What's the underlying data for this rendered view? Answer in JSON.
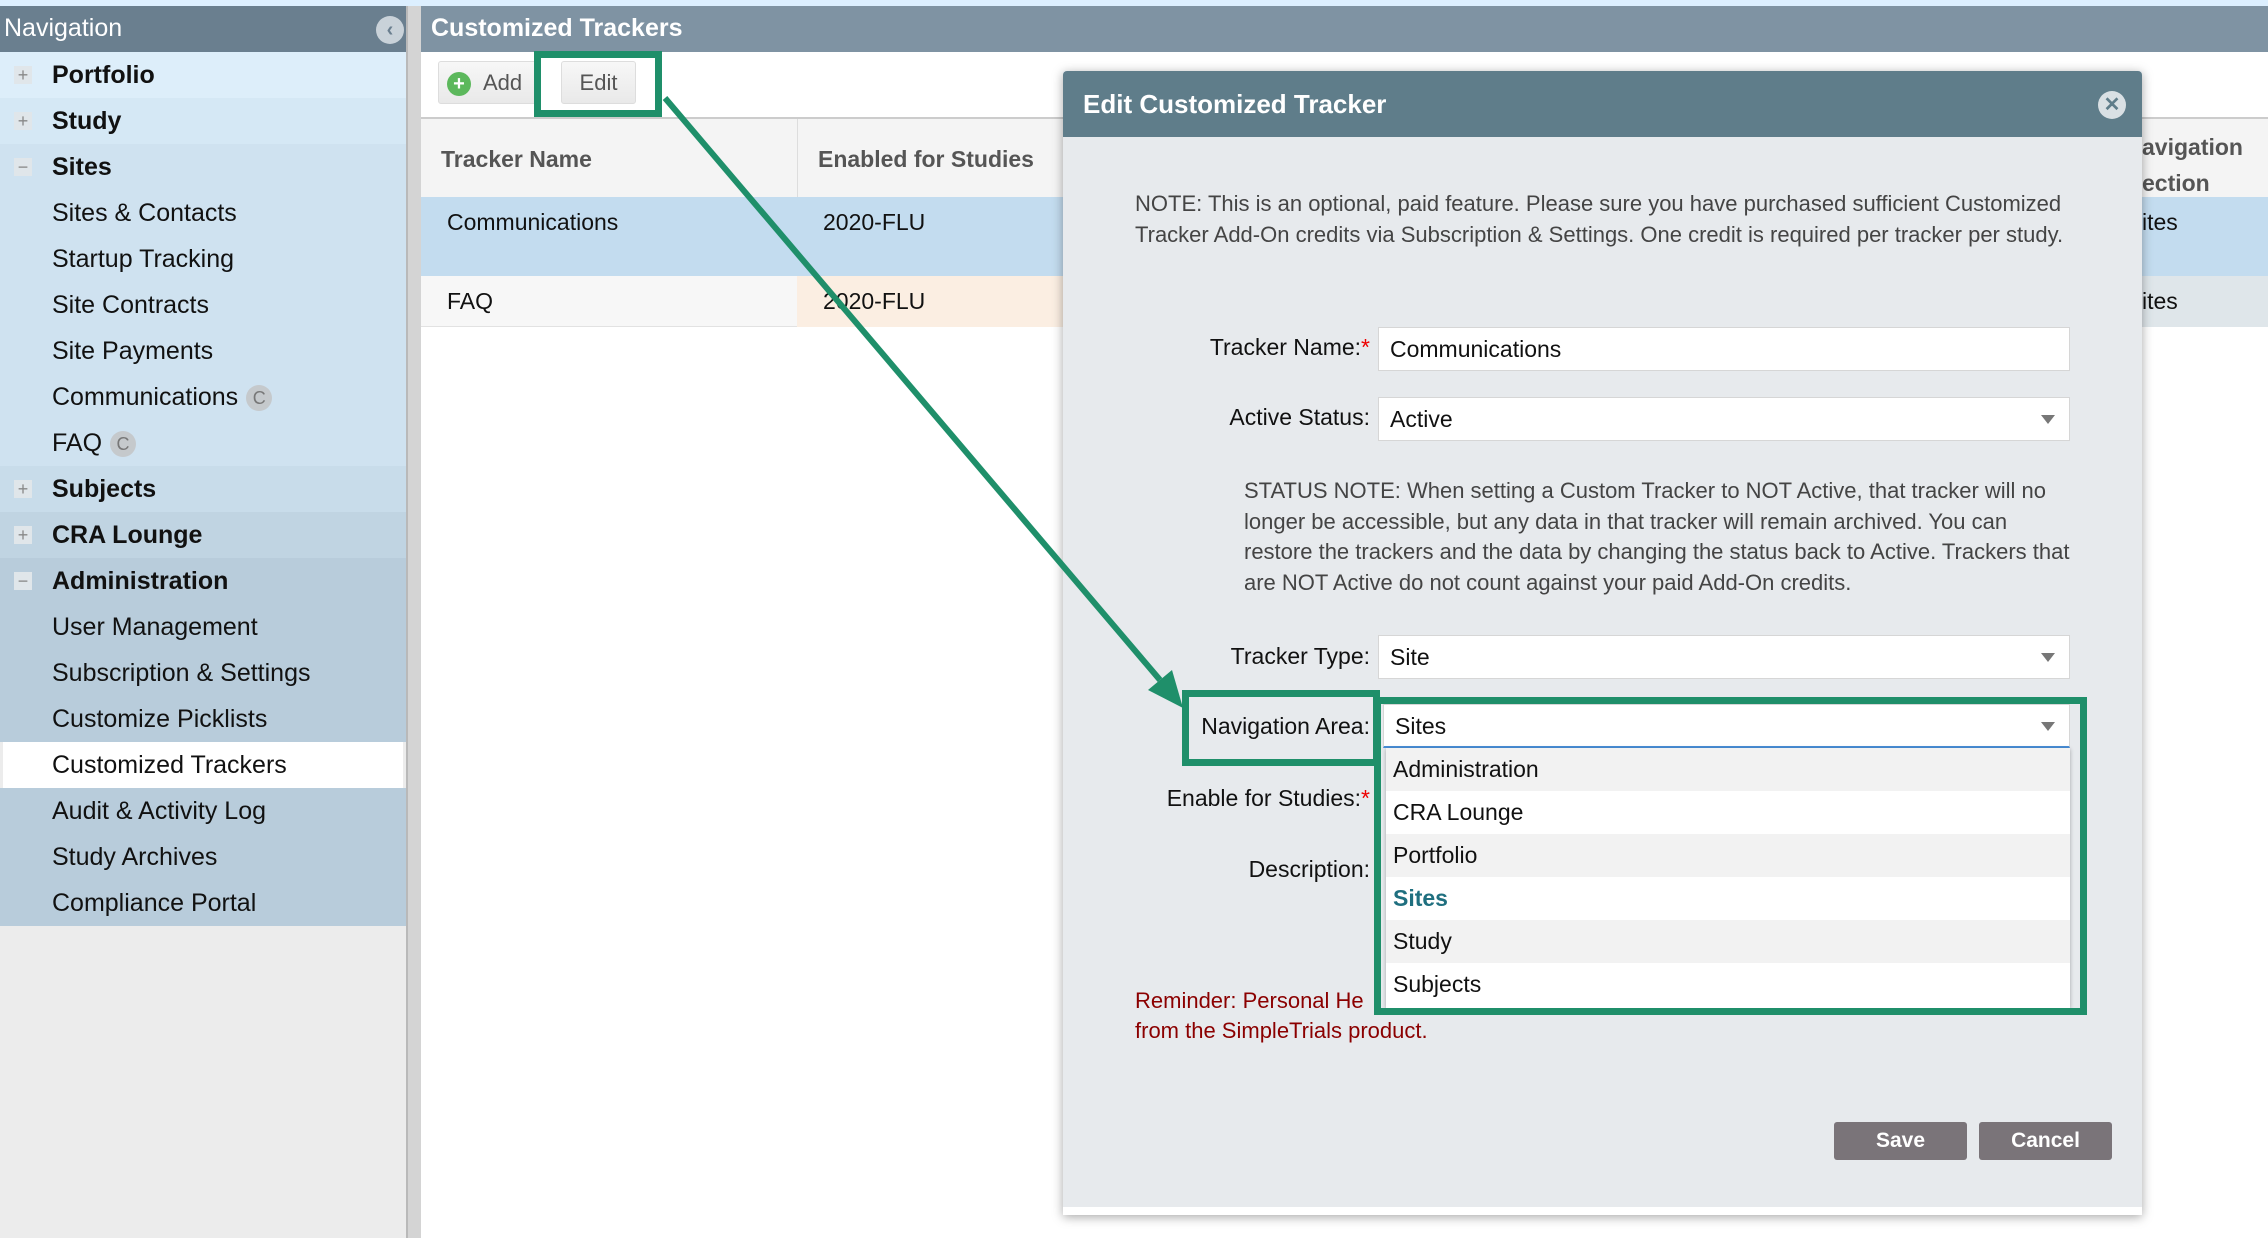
{
  "sidebar": {
    "title": "Navigation",
    "items": [
      {
        "label": "Portfolio",
        "type": "section",
        "expander": "+"
      },
      {
        "label": "Study",
        "type": "section",
        "expander": "+"
      },
      {
        "label": "Sites",
        "type": "section",
        "expander": "−"
      },
      {
        "label": "Sites & Contacts"
      },
      {
        "label": "Startup Tracking"
      },
      {
        "label": "Site Contracts"
      },
      {
        "label": "Site Payments"
      },
      {
        "label": "Communications",
        "badge": "C"
      },
      {
        "label": "FAQ",
        "badge": "C"
      },
      {
        "label": "Subjects",
        "type": "section",
        "expander": "+"
      },
      {
        "label": "CRA Lounge",
        "type": "section",
        "expander": "+"
      },
      {
        "label": "Administration",
        "type": "section",
        "expander": "−"
      },
      {
        "label": "User Management"
      },
      {
        "label": "Subscription & Settings"
      },
      {
        "label": "Customize Picklists"
      },
      {
        "label": "Customized Trackers",
        "selected": true
      },
      {
        "label": "Audit & Activity Log"
      },
      {
        "label": "Study Archives"
      },
      {
        "label": "Compliance Portal"
      }
    ]
  },
  "main": {
    "title": "Customized Trackers",
    "toolbar": {
      "add": "Add",
      "edit": "Edit"
    },
    "table": {
      "columns": [
        "Tracker Name",
        "Enabled for Studies",
        "avigation\nection"
      ],
      "rows": [
        [
          "Communications",
          "2020-FLU",
          "ites"
        ],
        [
          "FAQ",
          "2020-FLU",
          "ites"
        ]
      ]
    }
  },
  "modal": {
    "title": "Edit Customized Tracker",
    "note": "NOTE: This is an optional, paid feature. Please sure you have purchased sufficient Customized Tracker Add-On credits via Subscription & Settings. One credit is required per tracker per study.",
    "tracker_name_label": "Tracker Name:",
    "tracker_name_value": "Communications",
    "active_status_label": "Active Status:",
    "active_status_value": "Active",
    "status_note": "STATUS NOTE: When setting a Custom Tracker to NOT Active, that tracker will no longer be accessible, but any data in that tracker will remain archived. You can restore the trackers and the data by changing the status back to Active. Trackers that are NOT Active do not count against your paid Add-On credits.",
    "tracker_type_label": "Tracker Type:",
    "tracker_type_value": "Site",
    "navigation_area_label": "Navigation Area:",
    "navigation_area_value": "Sites",
    "navigation_area_options": [
      "Administration",
      "CRA Lounge",
      "Portfolio",
      "Sites",
      "Study",
      "Subjects"
    ],
    "enable_for_studies_label": "Enable for Studies:",
    "description_label": "Description:",
    "required_mark": "*",
    "reminder_line1": "Reminder: Personal He",
    "reminder_line2": "from the SimpleTrials product.",
    "save": "Save",
    "cancel": "Cancel"
  },
  "colors": {
    "highlight": "#1f8f6a",
    "modal_header": "#5f7d8a",
    "selected_option": "#1f6f7f",
    "reminder": "#8b0000"
  }
}
